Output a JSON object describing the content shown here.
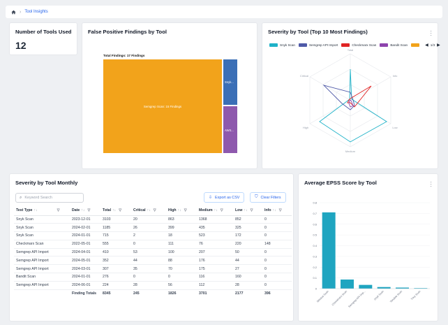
{
  "breadcrumb": {
    "current": "Tool Insights"
  },
  "tools_card": {
    "title": "Number of Tools Used",
    "value": "12"
  },
  "fp_card": {
    "title": "False Positive Findings by Tool",
    "total_label": "Total Findings: 17 Findings",
    "blocks": [
      {
        "label": "Semgrep Scan: 15 Findings",
        "value": 15,
        "color": "#f2a31b"
      },
      {
        "label": "Snyk...",
        "value": 1,
        "color": "#3b6fb6"
      },
      {
        "label": "AWS...",
        "value": 1,
        "color": "#8e59ad"
      }
    ]
  },
  "radar_card": {
    "title": "Severity by Tool (Top 10 Most Findings)",
    "legend": [
      {
        "name": "Snyk Scan",
        "color": "#1fb2c8"
      },
      {
        "name": "Semgrep API Import",
        "color": "#4f5aa8"
      },
      {
        "name": "Checkmarx Scan",
        "color": "#e02424"
      },
      {
        "name": "Bandit Scan",
        "color": "#8e44ad"
      },
      {
        "name": "",
        "color": "#f2a31b"
      }
    ],
    "pager": "1/3",
    "axes": [
      "Total",
      "Info",
      "Low",
      "Medium",
      "High",
      "Critical"
    ]
  },
  "table_card": {
    "title": "Severity by Tool Monthly",
    "search_placeholder": "Keyword Search",
    "export_label": "Export as CSV",
    "clear_label": "Clear Filters",
    "columns": [
      "Test Type",
      "Date",
      "Total",
      "Critical",
      "High",
      "Medium",
      "Low",
      "Info"
    ],
    "rows": [
      [
        "Snyk Scan",
        "2023-12-01",
        "3103",
        "20",
        "863",
        "1368",
        "852",
        "0"
      ],
      [
        "Snyk Scan",
        "2024-02-01",
        "1185",
        "26",
        "399",
        "435",
        "325",
        "0"
      ],
      [
        "Snyk Scan",
        "2024-01-01",
        "715",
        "2",
        "18",
        "523",
        "172",
        "0"
      ],
      [
        "Checkmarx Scan",
        "2022-05-01",
        "555",
        "0",
        "111",
        "76",
        "220",
        "148"
      ],
      [
        "Semgrep API Import",
        "2024-04-01",
        "410",
        "53",
        "100",
        "207",
        "50",
        "0"
      ],
      [
        "Semgrep API Import",
        "2024-05-01",
        "352",
        "44",
        "88",
        "176",
        "44",
        "0"
      ],
      [
        "Semgrep API Import",
        "2024-03-01",
        "307",
        "35",
        "70",
        "175",
        "27",
        "0"
      ],
      [
        "Bandit Scan",
        "2024-01-01",
        "276",
        "0",
        "0",
        "116",
        "160",
        "0"
      ],
      [
        "Semgrep API Import",
        "2024-06-01",
        "224",
        "28",
        "56",
        "112",
        "28",
        "0"
      ]
    ],
    "totals": [
      "",
      "Finding Totals",
      "8345",
      "245",
      "1826",
      "3701",
      "2177",
      "396"
    ]
  },
  "epss_card": {
    "title": "Average EPSS Score by Tool",
    "chart_data": {
      "type": "bar",
      "categories": [
        "Nessus Scan",
        "Checkmarx Scan",
        "Semgrep API Imp...",
        "Snyk Scan",
        "Tenable Scan",
        "Trivy Scan"
      ],
      "values": [
        0.71,
        0.085,
        0.035,
        0.015,
        0.01,
        0.005
      ],
      "yticks": [
        "0",
        "0.1",
        "0.2",
        "0.3",
        "0.4",
        "0.5",
        "0.6",
        "0.7",
        "0.8"
      ],
      "ylim": [
        0,
        0.8
      ],
      "color": "#1fa5c0"
    }
  }
}
